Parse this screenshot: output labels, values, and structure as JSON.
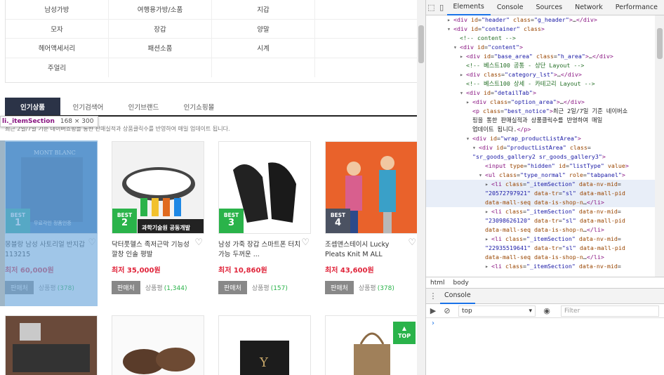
{
  "categories": [
    [
      "남성가방",
      "여행용가방/소품",
      "지갑",
      ""
    ],
    [
      "모자",
      "장갑",
      "양말",
      ""
    ],
    [
      "헤어액세서리",
      "패션소품",
      "시계",
      ""
    ],
    [
      "주얼리",
      "",
      "",
      ""
    ]
  ],
  "tabs": [
    "인기상품",
    "인기검색어",
    "인기브랜드",
    "인기쇼핑몰"
  ],
  "tab_more": "✔",
  "notice": "최근 2일/7일 기준 네이버쇼핑을 통한 판매실적과 상품클릭수를 반영하여 매일 업데이트 됩니다.",
  "tooltip": {
    "name": "li._itemSection",
    "size": "168 × 300"
  },
  "products": [
    {
      "rank": "1",
      "best": "BEST",
      "title": "몽블랑 남성 사토리얼 반지갑 113215",
      "price": "최저 60,000원",
      "seller": "판매처",
      "review_label": "상품평",
      "review_count": "(378)",
      "thumb_text": "무료각인 정품인증"
    },
    {
      "rank": "2",
      "best": "BEST",
      "title": "닥터풋헬스 족저근막 기능성깔창 인솔 평발",
      "price": "최저 35,000원",
      "seller": "판매처",
      "review_label": "상품평",
      "review_count": "(1,344)",
      "thumb_text": "과학기술원 공동개발"
    },
    {
      "rank": "3",
      "best": "BEST",
      "title": "남성 가죽 장갑 스마트폰 터치가능 두꺼운 ...",
      "price": "최저 10,860원",
      "seller": "판매처",
      "review_label": "상품평",
      "review_count": "(157)",
      "thumb_text": ""
    },
    {
      "rank": "4",
      "best": "BEST",
      "title": "조셉앤스테이시 Lucky Pleats Knit M ALL",
      "price": "최저 43,600원",
      "seller": "판매처",
      "review_label": "상품평",
      "review_count": "(378)",
      "thumb_text": ""
    }
  ],
  "top_button": "TOP",
  "devtools": {
    "tabs": [
      "Elements",
      "Console",
      "Sources",
      "Network",
      "Performance"
    ],
    "breadcrumbs": [
      "html",
      "body"
    ],
    "console_tab": "Console",
    "context": "top",
    "filter_placeholder": "Filter",
    "prompt": "›"
  },
  "colors": {
    "accent_red": "#e0243a",
    "accent_green": "#2ab34a",
    "tab_dark": "#2b3347"
  }
}
